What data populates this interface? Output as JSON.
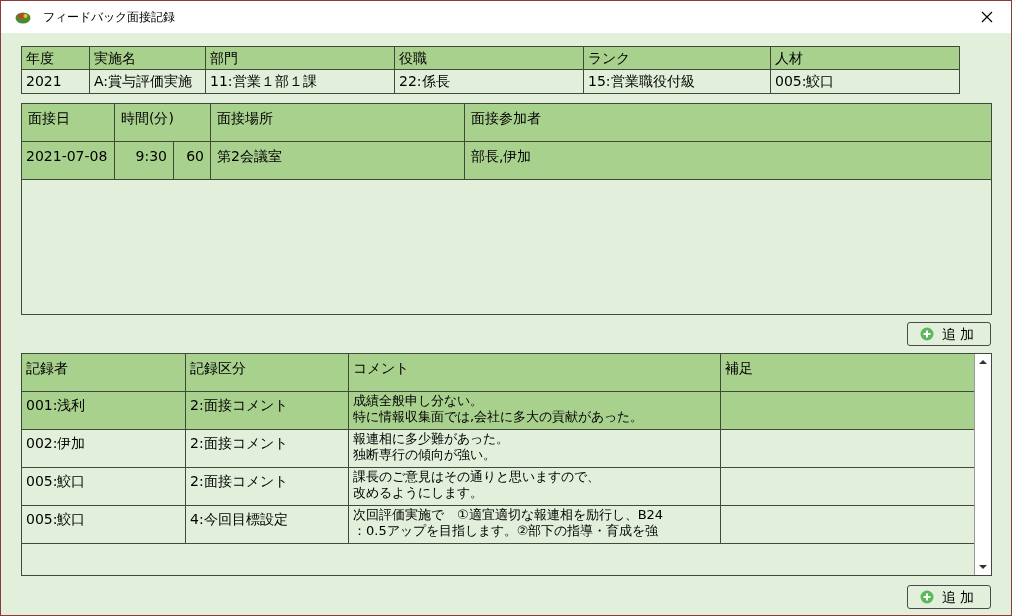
{
  "window": {
    "title": "フィードバック面接記録"
  },
  "summary": {
    "columns": [
      "年度",
      "実施名",
      "部門",
      "役職",
      "ランク",
      "人材"
    ],
    "values": [
      "2021",
      "A:賞与評価実施",
      "11:営業１部１課",
      "22:係長",
      "15:営業職役付級",
      "005:鮫口"
    ]
  },
  "interviews": {
    "columns": [
      "面接日",
      "時間(分)",
      "面接場所",
      "面接参加者"
    ],
    "rows": [
      {
        "date": "2021-07-08",
        "time": "9:30",
        "minutes": "60",
        "place": "第2会議室",
        "participants": "部長,伊加"
      }
    ]
  },
  "add_button_1": "追 加",
  "records": {
    "columns": [
      "記録者",
      "記録区分",
      "コメント",
      "補足"
    ],
    "rows": [
      {
        "recorder": "001:浅利",
        "category": "2:面接コメント",
        "comment": [
          "成績全般申し分ない。",
          "特に情報収集面では,会社に多大の貢献があった。"
        ],
        "selected": true
      },
      {
        "recorder": "002:伊加",
        "category": "2:面接コメント",
        "comment": [
          "報連相に多少難があった。",
          "独断専行の傾向が強い。"
        ],
        "selected": false
      },
      {
        "recorder": "005:鮫口",
        "category": "2:面接コメント",
        "comment": [
          "課長のご意見はその通りと思いますので、",
          "改めるようにします。"
        ],
        "selected": false
      },
      {
        "recorder": "005:鮫口",
        "category": "4:今回目標設定",
        "comment": [
          "次回評価実施で　①適宜適切な報連相を励行し、B24",
          "：0.5アップを目指します。②部下の指導・育成を強"
        ],
        "selected": false
      }
    ]
  },
  "add_button_2": "追 加"
}
